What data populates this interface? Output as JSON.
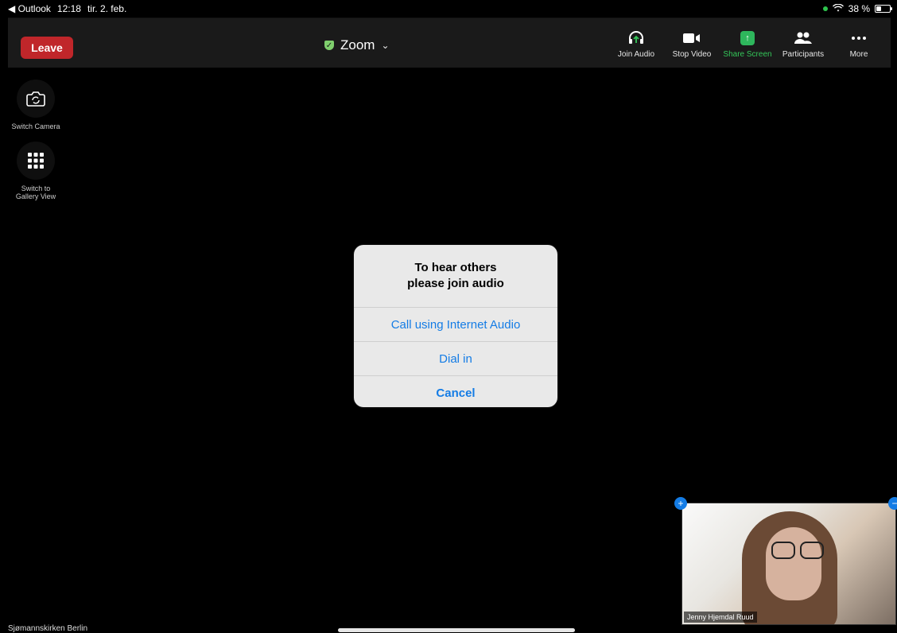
{
  "status_bar": {
    "back_app": "◀ Outlook",
    "time": "12:18",
    "date": "tir. 2. feb.",
    "battery_text": "38 %"
  },
  "topbar": {
    "leave_label": "Leave",
    "meeting_title": "Zoom",
    "controls": [
      {
        "label": "Join Audio",
        "icon": "headphones-icon"
      },
      {
        "label": "Stop Video",
        "icon": "video-icon"
      },
      {
        "label": "Share Screen",
        "icon": "share-screen-icon"
      },
      {
        "label": "Participants",
        "icon": "participants-icon"
      },
      {
        "label": "More",
        "icon": "more-icon"
      }
    ]
  },
  "side_controls": [
    {
      "label": "Switch Camera",
      "icon": "switch-camera-icon"
    },
    {
      "label": "Switch to\nGallery View",
      "icon": "gallery-icon"
    }
  ],
  "dialog": {
    "title": "To hear others\nplease join audio",
    "options": [
      "Call using Internet Audio",
      "Dial in",
      "Cancel"
    ]
  },
  "pip": {
    "name": "Jenny Hjemdal Ruud"
  },
  "bottom_left_label": "Sjømannskirken Berlin",
  "colors": {
    "leave_red": "#c0262a",
    "accent_blue": "#147ce5",
    "share_green": "#34c759"
  }
}
